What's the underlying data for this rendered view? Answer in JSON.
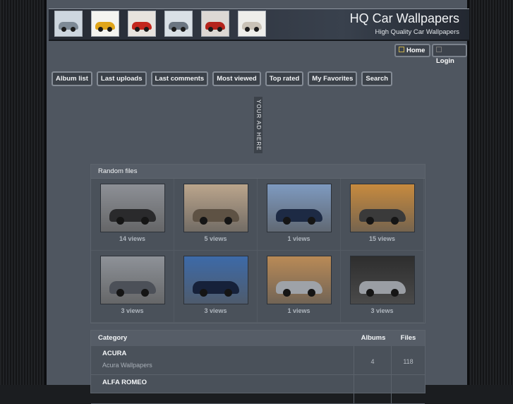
{
  "header": {
    "title": "HQ Car Wallpapers",
    "subtitle": "High Quality Car Wallpapers",
    "thumbnails": [
      {
        "icon": "car-photo-icon",
        "bg": "#cdd6df",
        "car": "#7e8a96"
      },
      {
        "icon": "car-photo-icon",
        "bg": "#f4f4f0",
        "car": "#e0a51a"
      },
      {
        "icon": "car-photo-icon",
        "bg": "#e7e3de",
        "car": "#c3261d"
      },
      {
        "icon": "car-photo-icon",
        "bg": "#d9e0e6",
        "car": "#6b7581"
      },
      {
        "icon": "car-photo-icon",
        "bg": "#dcd8d4",
        "car": "#b4241c"
      },
      {
        "icon": "car-photo-icon",
        "bg": "#eeeeea",
        "car": "#c9c2b6"
      }
    ]
  },
  "top_buttons": {
    "home": "Home",
    "login": "Login"
  },
  "nav": [
    "Album list",
    "Last uploads",
    "Last comments",
    "Most viewed",
    "Top rated",
    "My Favorites",
    "Search"
  ],
  "ad": "YOUR AD HERE",
  "random": {
    "title": "Random files",
    "items": [
      {
        "views": "14 views",
        "bg": "#8d9096",
        "car": "#2a2a2c"
      },
      {
        "views": "5 views",
        "bg": "#bba58c",
        "car": "#5e5244"
      },
      {
        "views": "1 views",
        "bg": "#7e9ac0",
        "car": "#1d2a44"
      },
      {
        "views": "15 views",
        "bg": "#c78a3e",
        "car": "#3a3a3a"
      },
      {
        "views": "3 views",
        "bg": "#8e9298",
        "car": "#4c5058"
      },
      {
        "views": "3 views",
        "bg": "#3d6aa8",
        "car": "#16213a"
      },
      {
        "views": "1 views",
        "bg": "#b98a56",
        "car": "#9ea2a8"
      },
      {
        "views": "3 views",
        "bg": "#2e2e2e",
        "car": "#9a9ea4"
      }
    ]
  },
  "categories": {
    "headers": {
      "category": "Category",
      "albums": "Albums",
      "files": "Files"
    },
    "rows": [
      {
        "name": "ACURA",
        "desc": "Acura Wallpapers",
        "albums": "4",
        "files": "118"
      },
      {
        "name": "ALFA ROMEO",
        "desc": "",
        "albums": "",
        "files": ""
      }
    ]
  }
}
